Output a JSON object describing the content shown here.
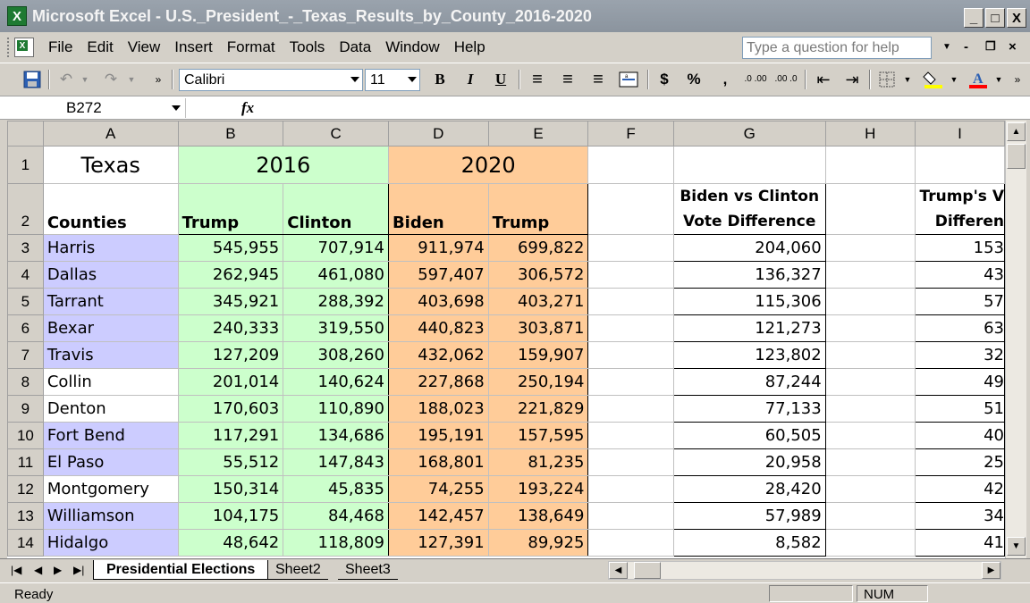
{
  "window": {
    "title": "Microsoft Excel - U.S._President_-_Texas_Results_by_County_2016-2020",
    "minimize": "_",
    "maximize": "□",
    "close": "X"
  },
  "menu": {
    "items": [
      "File",
      "Edit",
      "View",
      "Insert",
      "Format",
      "Tools",
      "Data",
      "Window",
      "Help"
    ],
    "help_placeholder": "Type a question for help"
  },
  "toolbar": {
    "font_name": "Calibri",
    "font_size": "11",
    "bold": "B",
    "italic": "I",
    "underline": "U",
    "currency": "$",
    "percent": "%",
    "comma": ",",
    "inc_decimal": ".0 .00",
    "dec_decimal": ".00 .0",
    "font_color_hex": "#ff0000",
    "fill_color_hex": "#ffff00"
  },
  "formula_bar": {
    "name_box": "B272",
    "fx": "fx",
    "formula": ""
  },
  "grid": {
    "columns": [
      "A",
      "B",
      "C",
      "D",
      "E",
      "F",
      "G",
      "H",
      "I"
    ],
    "row1": {
      "row": "1",
      "a": "Texas",
      "b_c": "2016",
      "d_e": "2020"
    },
    "row2": {
      "row": "2",
      "a": "Counties",
      "b": "Trump",
      "c": "Clinton",
      "d": "Biden",
      "e": "Trump",
      "g_line1": "Biden vs Clinton",
      "g_line2": "Vote Difference",
      "i_line1": "Trump's V",
      "i_line2": "Differen"
    },
    "rows": [
      {
        "row": "3",
        "county": "Harris",
        "t16": "545,955",
        "c16": "707,914",
        "b20": "911,974",
        "t20": "699,822",
        "diff": "204,060",
        "i": "153",
        "hl": true
      },
      {
        "row": "4",
        "county": "Dallas",
        "t16": "262,945",
        "c16": "461,080",
        "b20": "597,407",
        "t20": "306,572",
        "diff": "136,327",
        "i": "43",
        "hl": true
      },
      {
        "row": "5",
        "county": "Tarrant",
        "t16": "345,921",
        "c16": "288,392",
        "b20": "403,698",
        "t20": "403,271",
        "diff": "115,306",
        "i": "57",
        "hl": true
      },
      {
        "row": "6",
        "county": "Bexar",
        "t16": "240,333",
        "c16": "319,550",
        "b20": "440,823",
        "t20": "303,871",
        "diff": "121,273",
        "i": "63",
        "hl": true
      },
      {
        "row": "7",
        "county": "Travis",
        "t16": "127,209",
        "c16": "308,260",
        "b20": "432,062",
        "t20": "159,907",
        "diff": "123,802",
        "i": "32",
        "hl": true
      },
      {
        "row": "8",
        "county": "Collin",
        "t16": "201,014",
        "c16": "140,624",
        "b20": "227,868",
        "t20": "250,194",
        "diff": "87,244",
        "i": "49",
        "hl": false
      },
      {
        "row": "9",
        "county": "Denton",
        "t16": "170,603",
        "c16": "110,890",
        "b20": "188,023",
        "t20": "221,829",
        "diff": "77,133",
        "i": "51",
        "hl": false
      },
      {
        "row": "10",
        "county": "Fort Bend",
        "t16": "117,291",
        "c16": "134,686",
        "b20": "195,191",
        "t20": "157,595",
        "diff": "60,505",
        "i": "40",
        "hl": true
      },
      {
        "row": "11",
        "county": "El Paso",
        "t16": "55,512",
        "c16": "147,843",
        "b20": "168,801",
        "t20": "81,235",
        "diff": "20,958",
        "i": "25",
        "hl": true
      },
      {
        "row": "12",
        "county": "Montgomery",
        "t16": "150,314",
        "c16": "45,835",
        "b20": "74,255",
        "t20": "193,224",
        "diff": "28,420",
        "i": "42",
        "hl": false
      },
      {
        "row": "13",
        "county": "Williamson",
        "t16": "104,175",
        "c16": "84,468",
        "b20": "142,457",
        "t20": "138,649",
        "diff": "57,989",
        "i": "34",
        "hl": true
      },
      {
        "row": "14",
        "county": "Hidalgo",
        "t16": "48,642",
        "c16": "118,809",
        "b20": "127,391",
        "t20": "89,925",
        "diff": "8,582",
        "i": "41",
        "hl": true
      }
    ],
    "colors": {
      "green": "#ccffcc",
      "orange": "#ffcc99",
      "lavender": "#ccccff"
    }
  },
  "sheets": {
    "tabs": [
      "Presidential Elections",
      "Sheet2",
      "Sheet3"
    ],
    "active": "Presidential Elections"
  },
  "status": {
    "left": "Ready",
    "num": "NUM"
  }
}
